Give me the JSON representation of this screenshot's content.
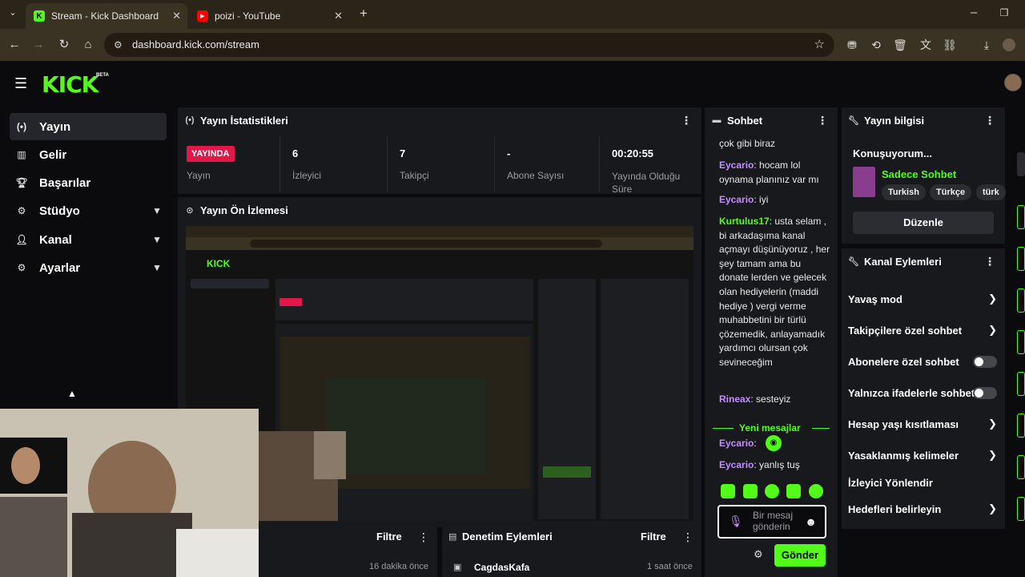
{
  "browser": {
    "tabs": [
      {
        "title": "Stream - Kick Dashboard",
        "favicon": "K"
      },
      {
        "title": "poizi - YouTube",
        "favicon": "▶"
      }
    ],
    "url": "dashboard.kick.com/stream"
  },
  "app": {
    "logo": "KICK",
    "logo_badge": "BETA"
  },
  "sidebar": {
    "items": [
      {
        "label": "Yayın",
        "icon": "broadcast-icon",
        "active": true
      },
      {
        "label": "Gelir",
        "icon": "chart-icon"
      },
      {
        "label": "Başarılar",
        "icon": "trophy-icon"
      },
      {
        "label": "Stüdyo",
        "icon": "gear-icon",
        "expandable": true
      },
      {
        "label": "Kanal",
        "icon": "user-icon",
        "expandable": true
      },
      {
        "label": "Ayarlar",
        "icon": "settings-icon",
        "expandable": true
      }
    ]
  },
  "stats": {
    "title": "Yayın İstatistikleri",
    "live_badge": "YAYINDA",
    "live_label": "Yayın",
    "cells": [
      {
        "value": "6",
        "label": "İzleyici"
      },
      {
        "value": "7",
        "label": "Takipçi"
      },
      {
        "value": "-",
        "label": "Abone Sayısı"
      },
      {
        "value": "00:20:55",
        "label": "Yayında Olduğu Süre"
      }
    ]
  },
  "preview": {
    "title": "Yayın Ön İzlemesi"
  },
  "bottom": {
    "left_filter": "Filtre",
    "left_time": "16 dakika önce",
    "mod_title": "Denetim Eylemleri",
    "mod_filter": "Filtre",
    "mod_user": "CagdasKafa",
    "mod_time": "1 saat önce"
  },
  "chat": {
    "title": "Sohbet",
    "messages": [
      {
        "user": "",
        "text": "çok gibi biraz"
      },
      {
        "user": "Eycario",
        "text": "hocam lol oynama planınız var mı"
      },
      {
        "user": "Eycario",
        "text": "iyi"
      },
      {
        "user": "Kurtulus17",
        "text": "usta selam , bi arkadaşıma kanal açmayı düşünüyoruz , her şey tamam ama bu donate lerden ve gelecek olan hediyelerin (maddi hediye ) vergi verme muhabbetini bir türlü çözemedik, anlayamadık yardımcı olursan çok sevineceğim"
      },
      {
        "user": "Rineax",
        "text": "sesteyiz"
      },
      {
        "user": "Eycario",
        "text": ""
      },
      {
        "user": "Eycario",
        "text": "yanlış tuş"
      }
    ],
    "new_messages": "Yeni mesajlar",
    "input_placeholder": "Bir mesaj gönderin",
    "send": "Gönder"
  },
  "stream_info": {
    "title": "Yayın bilgisi",
    "stream_title": "Konuşuyorum...",
    "category": "Sadece Sohbet",
    "tags": [
      "Turkish",
      "Türkçe",
      "türk"
    ],
    "edit": "Düzenle"
  },
  "channel_actions": {
    "title": "Kanal Eylemleri",
    "items": [
      {
        "label": "Yavaş mod",
        "control": "arrow"
      },
      {
        "label": "Takipçilere özel sohbet",
        "control": "arrow"
      },
      {
        "label": "Abonelere özel sohbet",
        "control": "toggle"
      },
      {
        "label": "Yalnızca ifadelerle sohbet",
        "control": "toggle"
      },
      {
        "label": "Hesap yaşı kısıtlaması",
        "control": "arrow"
      },
      {
        "label": "Yasaklanmış kelimeler",
        "control": "arrow"
      },
      {
        "label": "İzleyici Yönlendir",
        "control": "none"
      },
      {
        "label": "Hedefleri belirleyin",
        "control": "arrow"
      }
    ]
  },
  "colors": {
    "accent": "#53fc18",
    "live": "#e3174a",
    "username": "#c48cff"
  }
}
